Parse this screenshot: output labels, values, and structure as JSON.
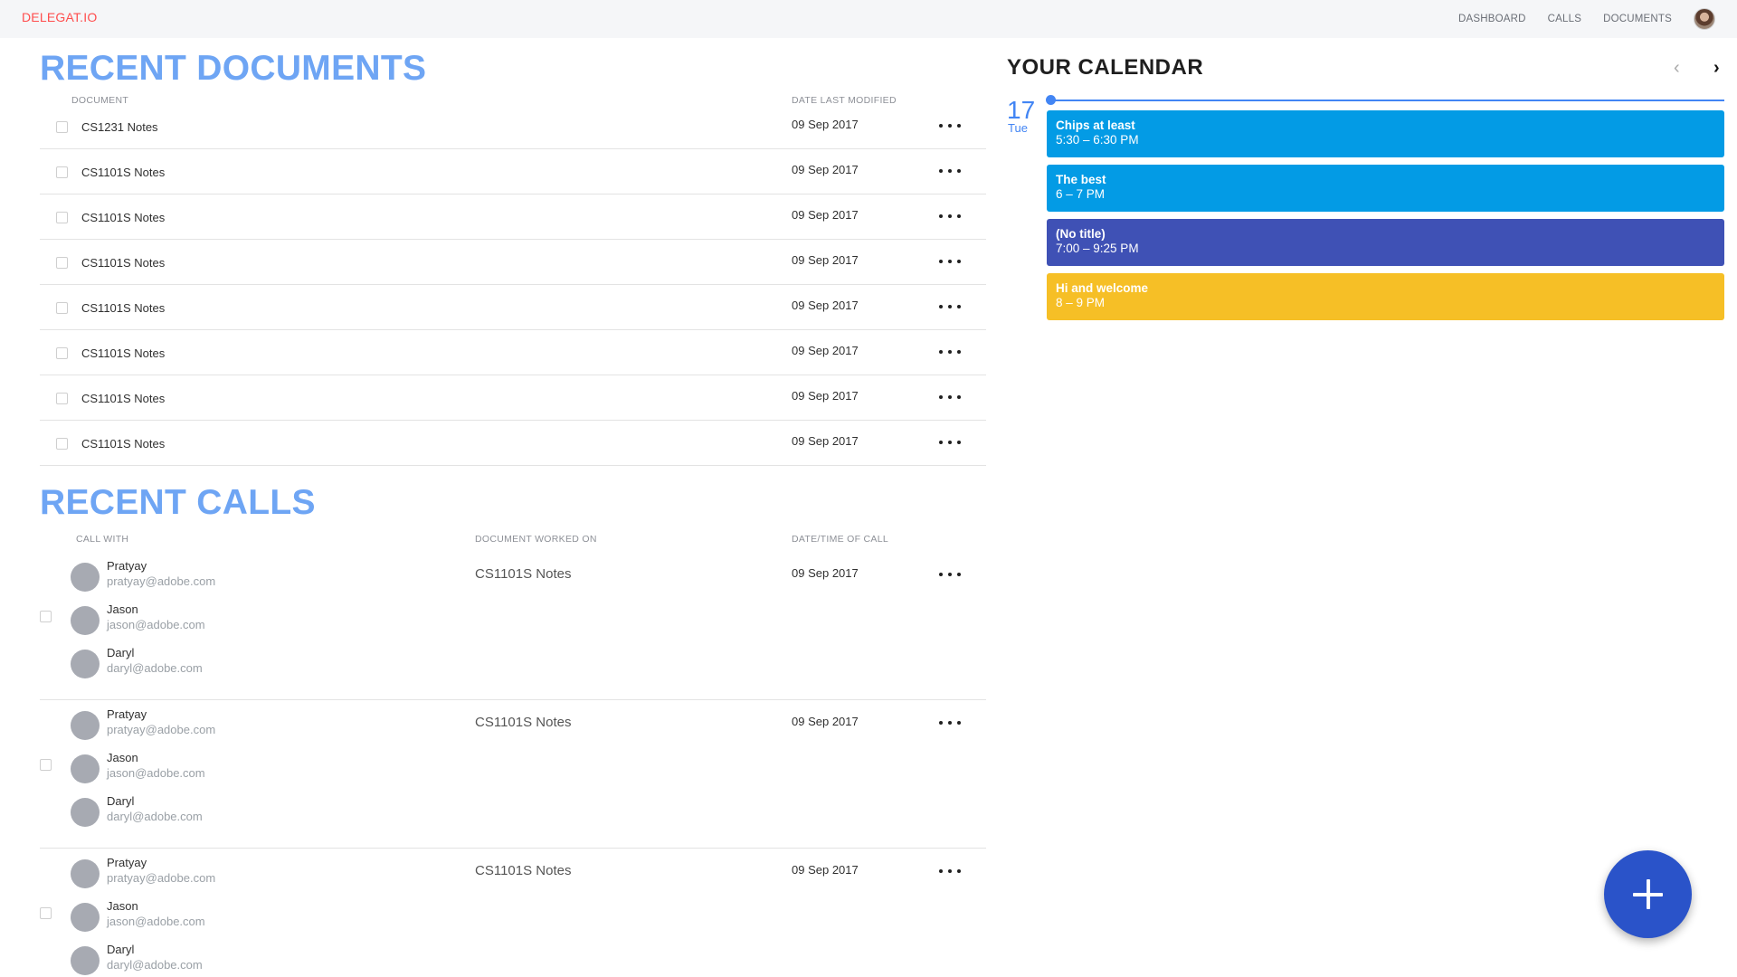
{
  "topbar": {
    "brand": "DELEGAT.IO",
    "nav": [
      "DASHBOARD",
      "CALLS",
      "DOCUMENTS"
    ]
  },
  "documents": {
    "title": "RECENT DOCUMENTS",
    "headers": {
      "document": "DOCUMENT",
      "date": "DATE LAST MODIFIED"
    },
    "rows": [
      {
        "name": "CS1231 Notes",
        "date": "09 Sep 2017"
      },
      {
        "name": "CS1101S Notes",
        "date": "09 Sep 2017"
      },
      {
        "name": "CS1101S Notes",
        "date": "09 Sep 2017"
      },
      {
        "name": "CS1101S Notes",
        "date": "09 Sep 2017"
      },
      {
        "name": "CS1101S Notes",
        "date": "09 Sep 2017"
      },
      {
        "name": "CS1101S Notes",
        "date": "09 Sep 2017"
      },
      {
        "name": "CS1101S Notes",
        "date": "09 Sep 2017"
      },
      {
        "name": "CS1101S Notes",
        "date": "09 Sep 2017"
      }
    ]
  },
  "calls": {
    "title": "RECENT CALLS",
    "headers": {
      "call_with": "CALL WITH",
      "document": "DOCUMENT WORKED ON",
      "datetime": "DATE/TIME OF CALL"
    },
    "rows": [
      {
        "participants": [
          {
            "name": "Pratyay",
            "email": "pratyay@adobe.com"
          },
          {
            "name": "Jason",
            "email": "jason@adobe.com"
          },
          {
            "name": "Daryl",
            "email": "daryl@adobe.com"
          }
        ],
        "document": "CS1101S Notes",
        "date": "09 Sep 2017"
      },
      {
        "participants": [
          {
            "name": "Pratyay",
            "email": "pratyay@adobe.com"
          },
          {
            "name": "Jason",
            "email": "jason@adobe.com"
          },
          {
            "name": "Daryl",
            "email": "daryl@adobe.com"
          }
        ],
        "document": "CS1101S Notes",
        "date": "09 Sep 2017"
      },
      {
        "participants": [
          {
            "name": "Pratyay",
            "email": "pratyay@adobe.com"
          },
          {
            "name": "Jason",
            "email": "jason@adobe.com"
          },
          {
            "name": "Daryl",
            "email": "daryl@adobe.com"
          }
        ],
        "document": "CS1101S Notes",
        "date": "09 Sep 2017"
      }
    ]
  },
  "calendar": {
    "title": "YOUR CALENDAR",
    "prev_icon": "chevron-left-icon",
    "next_icon": "chevron-right-icon",
    "day_number": "17",
    "day_name": "Tue",
    "events": [
      {
        "title": "Chips at least",
        "time": "5:30 – 6:30 PM",
        "color": "#039be5"
      },
      {
        "title": "The best",
        "time": "6 – 7 PM",
        "color": "#039be5"
      },
      {
        "title": "(No title)",
        "time": "7:00 – 9:25 PM",
        "color": "#3f51b5"
      },
      {
        "title": "Hi and welcome",
        "time": "8 – 9 PM",
        "color": "#f6bf26"
      }
    ]
  },
  "fab": {
    "icon": "plus-icon",
    "color": "#2a53c9"
  },
  "colors": {
    "brand": "#ff4d4d",
    "heading": "#6ea5f4",
    "today": "#4285f4"
  }
}
